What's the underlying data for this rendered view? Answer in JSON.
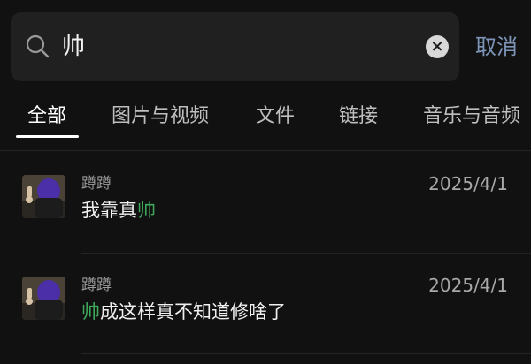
{
  "search": {
    "query": "帅",
    "cancel_label": "取消",
    "clear_icon": "clear-icon"
  },
  "tabs": [
    {
      "label": "全部",
      "active": true
    },
    {
      "label": "图片与视频",
      "active": false
    },
    {
      "label": "文件",
      "active": false
    },
    {
      "label": "链接",
      "active": false
    },
    {
      "label": "音乐与音频",
      "active": false
    }
  ],
  "results": [
    {
      "sender": "蹲蹲",
      "date": "2025/4/1",
      "message_before": "我靠真",
      "message_highlight": "帅",
      "message_after": ""
    },
    {
      "sender": "蹲蹲",
      "date": "2025/4/1",
      "message_before": "",
      "message_highlight": "帅",
      "message_after": "成这样真不知道修啥了"
    }
  ],
  "colors": {
    "background": "#111111",
    "accent_highlight": "#3ea95a",
    "cancel_link": "#7d95b8"
  }
}
